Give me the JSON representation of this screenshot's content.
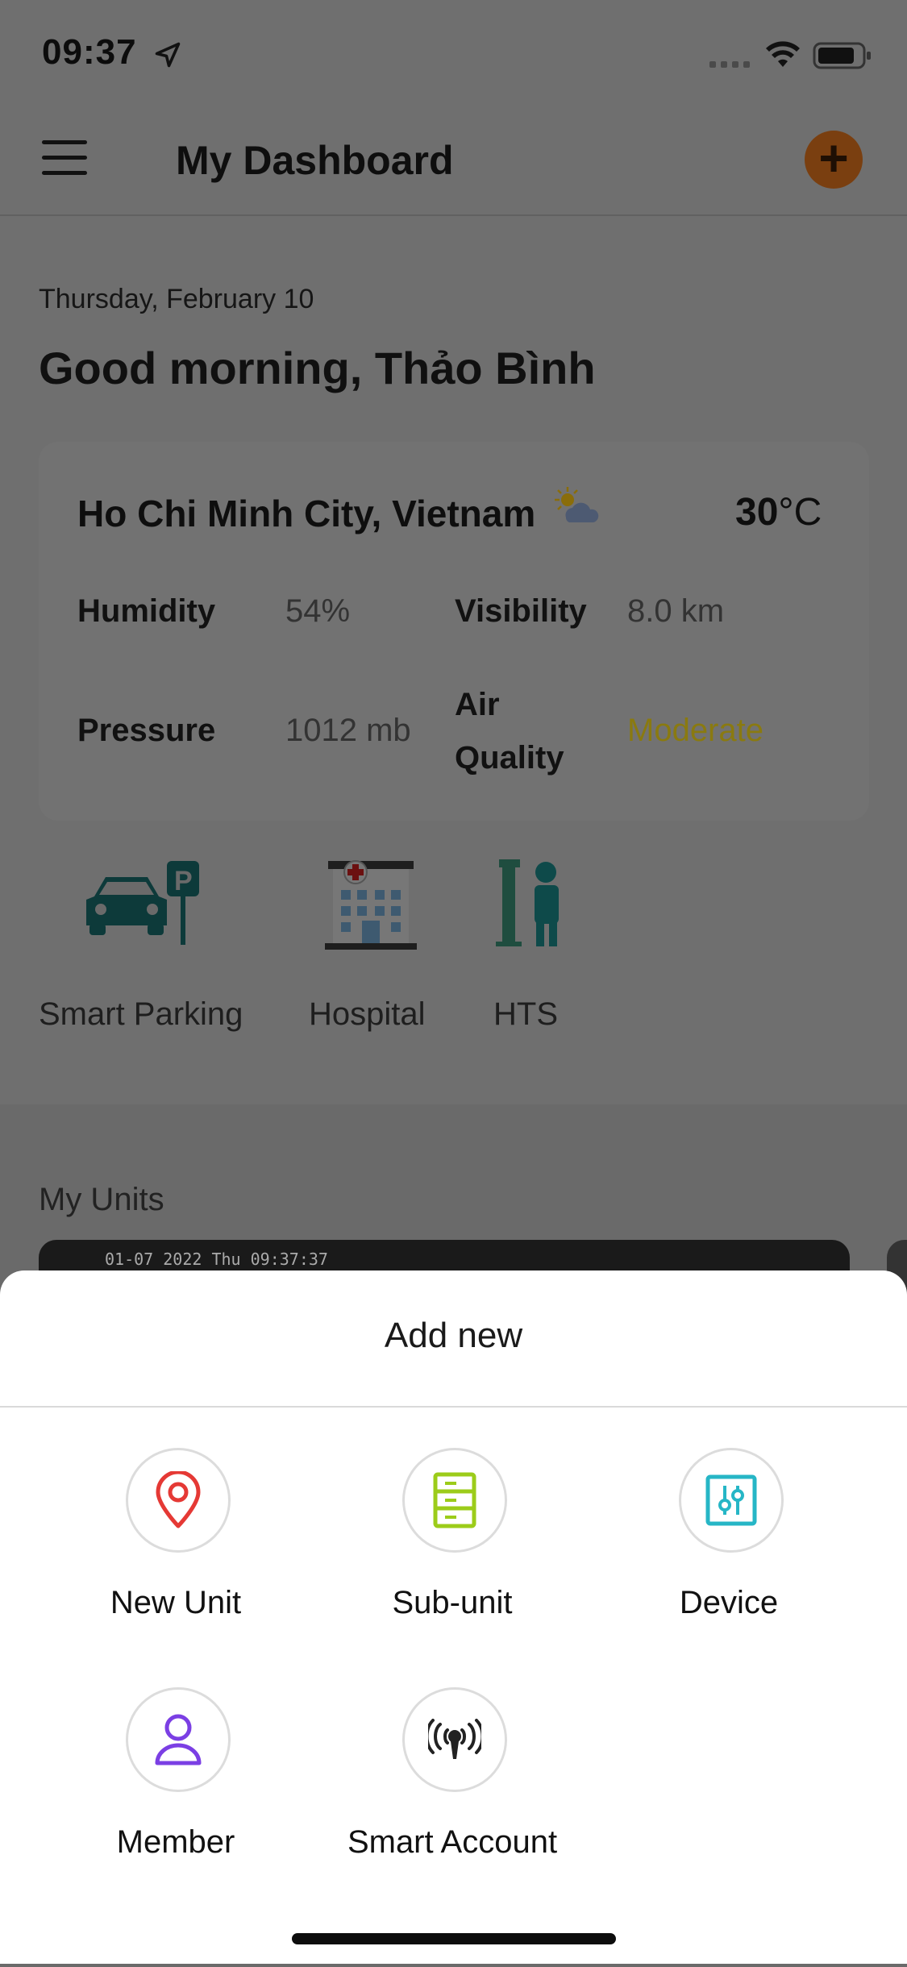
{
  "status_bar": {
    "time": "09:37"
  },
  "header": {
    "title": "My Dashboard",
    "add_symbol": "+"
  },
  "greeting": {
    "date": "Thursday, February 10",
    "text": "Good morning, Thảo Bình"
  },
  "weather": {
    "city": "Ho Chi Minh City, Vietnam",
    "temp_value": "30",
    "temp_unit": "°C",
    "icon": "sun-cloud-icon",
    "humidity_label": "Humidity",
    "humidity_value": "54%",
    "visibility_label": "Visibility",
    "visibility_value": "8.0 km",
    "pressure_label": "Pressure",
    "pressure_value": "1012 mb",
    "air_quality_label_1": "Air",
    "air_quality_label_2": "Quality",
    "air_quality_value": "Moderate"
  },
  "services": [
    {
      "label": "Smart Parking",
      "icon": "parking-car-icon"
    },
    {
      "label": "Hospital",
      "icon": "hospital-icon"
    },
    {
      "label": "HTS",
      "icon": "hts-logo-icon"
    }
  ],
  "units": {
    "title": "My Units",
    "camera_overlay": "01-07 2022 Thu 09:37:37"
  },
  "sheet": {
    "title": "Add new",
    "options": [
      {
        "label": "New Unit",
        "icon": "map-pin-icon",
        "color": "#e53935"
      },
      {
        "label": "Sub-unit",
        "icon": "server-icon",
        "color": "#9ccc1a"
      },
      {
        "label": "Device",
        "icon": "sliders-icon",
        "color": "#26b6c6"
      },
      {
        "label": "Member",
        "icon": "user-icon",
        "color": "#7b3fe4"
      },
      {
        "label": "Smart Account",
        "icon": "broadcast-icon",
        "color": "#222222"
      }
    ]
  },
  "colors": {
    "accent": "#f07a1c",
    "overlay": "#6f6f6f"
  }
}
